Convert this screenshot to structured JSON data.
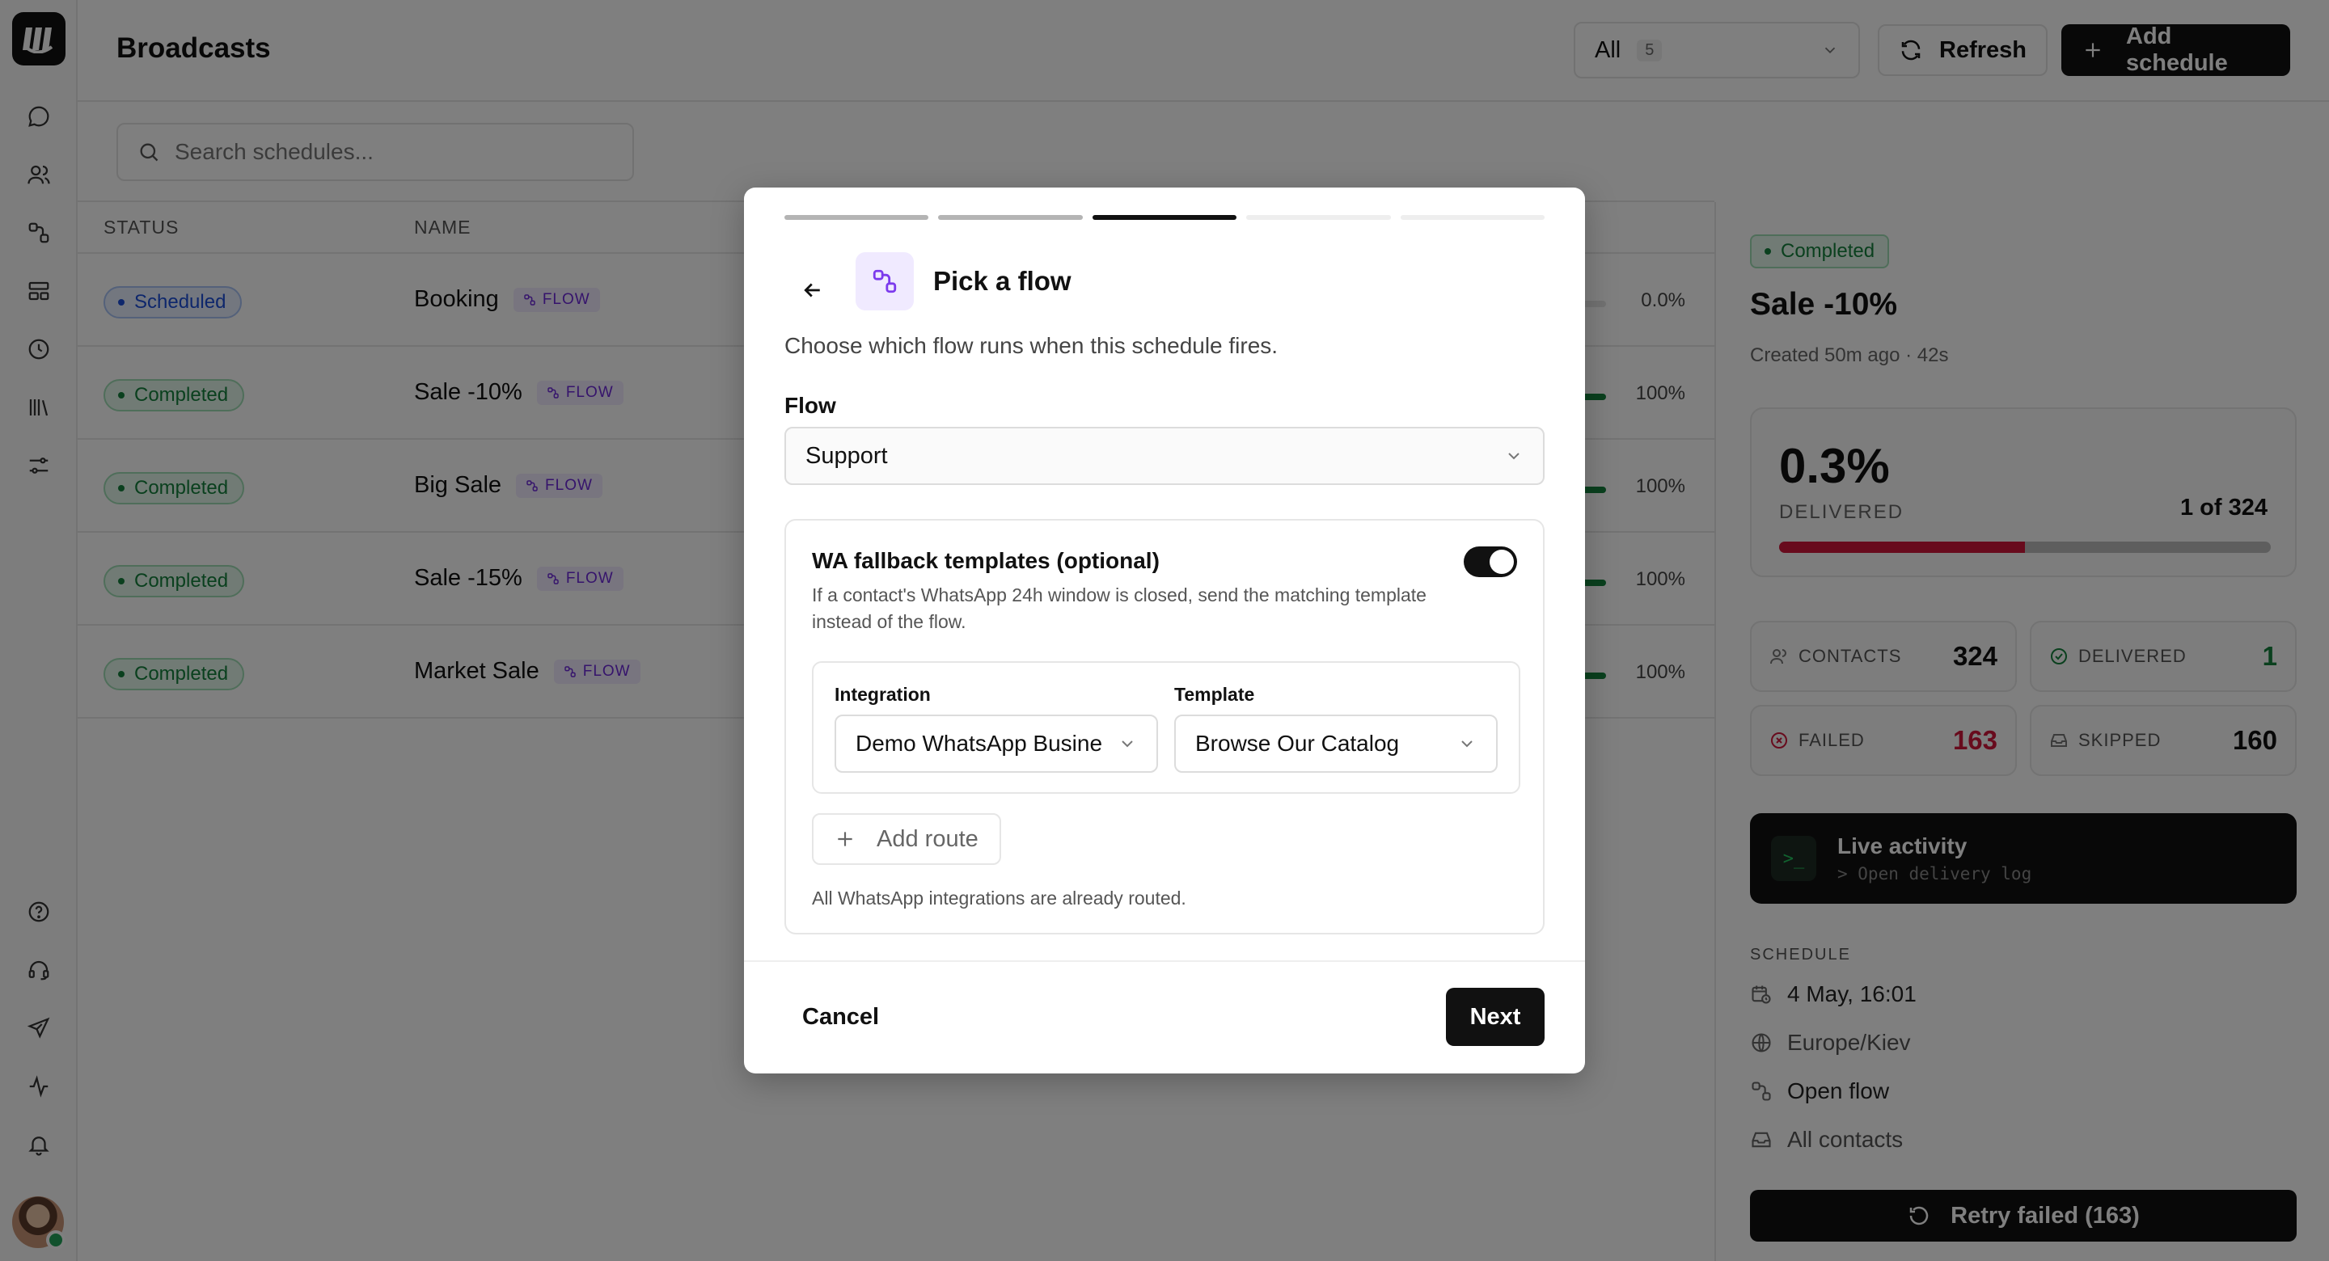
{
  "header": {
    "title": "Broadcasts",
    "filter": {
      "value": "All",
      "count": "5"
    },
    "refresh_label": "Refresh",
    "add_label": "Add schedule"
  },
  "search": {
    "placeholder": "Search schedules..."
  },
  "table": {
    "headers": {
      "status": "STATUS",
      "name": "NAME"
    },
    "flow_tag": "FLOW",
    "rows": [
      {
        "status": "Scheduled",
        "name": "Booking",
        "pct": "0.0%"
      },
      {
        "status": "Completed",
        "name": "Sale -10%",
        "pct": "100%"
      },
      {
        "status": "Completed",
        "name": "Big Sale",
        "pct": "100%"
      },
      {
        "status": "Completed",
        "name": "Sale -15%",
        "pct": "100%"
      },
      {
        "status": "Completed",
        "name": "Market Sale",
        "pct": "100%"
      }
    ]
  },
  "panel": {
    "status": "Completed",
    "title": "Sale -10%",
    "subtitle": "Created 50m ago · 42s",
    "delivered_pct": "0.3%",
    "delivered_label": "DELIVERED",
    "delivered_count": "1 of 324",
    "failed_fraction": 0.5,
    "stats": {
      "contacts_label": "CONTACTS",
      "contacts": "324",
      "delivered_label": "DELIVERED",
      "delivered": "1",
      "failed_label": "FAILED",
      "failed": "163",
      "skipped_label": "SKIPPED",
      "skipped": "160"
    },
    "live_title": "Live activity",
    "live_sub": "> Open delivery log",
    "schedule_label": "SCHEDULE",
    "schedule": {
      "date": "4 May, 16:01",
      "timezone": "Europe/Kiev",
      "flow": "Open flow",
      "audience": "All contacts"
    },
    "retry_label": "Retry failed (163)"
  },
  "modal": {
    "steps": [
      "done",
      "done",
      "active",
      "todo",
      "todo"
    ],
    "title": "Pick a flow",
    "description": "Choose which flow runs when this schedule fires.",
    "flow_label": "Flow",
    "flow_value": "Support",
    "fallback": {
      "title": "WA fallback templates (optional)",
      "description": "If a contact's WhatsApp 24h window is closed, send the matching template instead of the flow.",
      "enabled": true,
      "integration_label": "Integration",
      "integration_value": "Demo WhatsApp Busine",
      "template_label": "Template",
      "template_value": "Browse Our Catalog",
      "add_route_label": "Add route",
      "note": "All WhatsApp integrations are already routed."
    },
    "cancel_label": "Cancel",
    "next_label": "Next"
  },
  "colors": {
    "accent": "#111111",
    "success": "#15803d",
    "failed": "#d1173a",
    "flow_purple": "#7c3aed"
  }
}
